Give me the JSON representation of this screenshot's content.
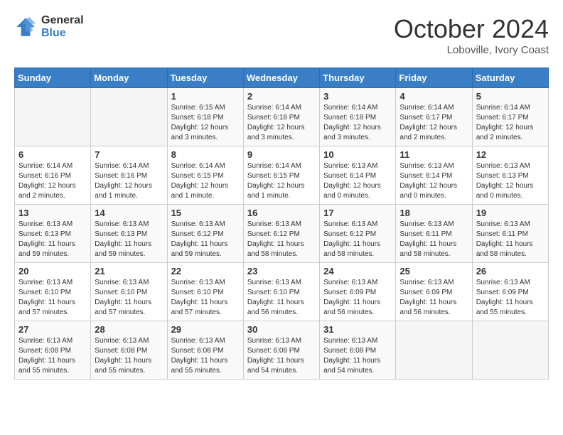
{
  "header": {
    "logo_general": "General",
    "logo_blue": "Blue",
    "month": "October 2024",
    "location": "Loboville, Ivory Coast"
  },
  "weekdays": [
    "Sunday",
    "Monday",
    "Tuesday",
    "Wednesday",
    "Thursday",
    "Friday",
    "Saturday"
  ],
  "weeks": [
    [
      {
        "day": "",
        "empty": true
      },
      {
        "day": "",
        "empty": true
      },
      {
        "day": "1",
        "sunrise": "6:15 AM",
        "sunset": "6:18 PM",
        "daylight": "12 hours and 3 minutes."
      },
      {
        "day": "2",
        "sunrise": "6:14 AM",
        "sunset": "6:18 PM",
        "daylight": "12 hours and 3 minutes."
      },
      {
        "day": "3",
        "sunrise": "6:14 AM",
        "sunset": "6:18 PM",
        "daylight": "12 hours and 3 minutes."
      },
      {
        "day": "4",
        "sunrise": "6:14 AM",
        "sunset": "6:17 PM",
        "daylight": "12 hours and 2 minutes."
      },
      {
        "day": "5",
        "sunrise": "6:14 AM",
        "sunset": "6:17 PM",
        "daylight": "12 hours and 2 minutes."
      }
    ],
    [
      {
        "day": "6",
        "sunrise": "6:14 AM",
        "sunset": "6:16 PM",
        "daylight": "12 hours and 2 minutes."
      },
      {
        "day": "7",
        "sunrise": "6:14 AM",
        "sunset": "6:16 PM",
        "daylight": "12 hours and 1 minute."
      },
      {
        "day": "8",
        "sunrise": "6:14 AM",
        "sunset": "6:15 PM",
        "daylight": "12 hours and 1 minute."
      },
      {
        "day": "9",
        "sunrise": "6:14 AM",
        "sunset": "6:15 PM",
        "daylight": "12 hours and 1 minute."
      },
      {
        "day": "10",
        "sunrise": "6:13 AM",
        "sunset": "6:14 PM",
        "daylight": "12 hours and 0 minutes."
      },
      {
        "day": "11",
        "sunrise": "6:13 AM",
        "sunset": "6:14 PM",
        "daylight": "12 hours and 0 minutes."
      },
      {
        "day": "12",
        "sunrise": "6:13 AM",
        "sunset": "6:13 PM",
        "daylight": "12 hours and 0 minutes."
      }
    ],
    [
      {
        "day": "13",
        "sunrise": "6:13 AM",
        "sunset": "6:13 PM",
        "daylight": "11 hours and 59 minutes."
      },
      {
        "day": "14",
        "sunrise": "6:13 AM",
        "sunset": "6:13 PM",
        "daylight": "11 hours and 59 minutes."
      },
      {
        "day": "15",
        "sunrise": "6:13 AM",
        "sunset": "6:12 PM",
        "daylight": "11 hours and 59 minutes."
      },
      {
        "day": "16",
        "sunrise": "6:13 AM",
        "sunset": "6:12 PM",
        "daylight": "11 hours and 58 minutes."
      },
      {
        "day": "17",
        "sunrise": "6:13 AM",
        "sunset": "6:12 PM",
        "daylight": "11 hours and 58 minutes."
      },
      {
        "day": "18",
        "sunrise": "6:13 AM",
        "sunset": "6:11 PM",
        "daylight": "11 hours and 58 minutes."
      },
      {
        "day": "19",
        "sunrise": "6:13 AM",
        "sunset": "6:11 PM",
        "daylight": "11 hours and 58 minutes."
      }
    ],
    [
      {
        "day": "20",
        "sunrise": "6:13 AM",
        "sunset": "6:10 PM",
        "daylight": "11 hours and 57 minutes."
      },
      {
        "day": "21",
        "sunrise": "6:13 AM",
        "sunset": "6:10 PM",
        "daylight": "11 hours and 57 minutes."
      },
      {
        "day": "22",
        "sunrise": "6:13 AM",
        "sunset": "6:10 PM",
        "daylight": "11 hours and 57 minutes."
      },
      {
        "day": "23",
        "sunrise": "6:13 AM",
        "sunset": "6:10 PM",
        "daylight": "11 hours and 56 minutes."
      },
      {
        "day": "24",
        "sunrise": "6:13 AM",
        "sunset": "6:09 PM",
        "daylight": "11 hours and 56 minutes."
      },
      {
        "day": "25",
        "sunrise": "6:13 AM",
        "sunset": "6:09 PM",
        "daylight": "11 hours and 56 minutes."
      },
      {
        "day": "26",
        "sunrise": "6:13 AM",
        "sunset": "6:09 PM",
        "daylight": "11 hours and 55 minutes."
      }
    ],
    [
      {
        "day": "27",
        "sunrise": "6:13 AM",
        "sunset": "6:08 PM",
        "daylight": "11 hours and 55 minutes."
      },
      {
        "day": "28",
        "sunrise": "6:13 AM",
        "sunset": "6:08 PM",
        "daylight": "11 hours and 55 minutes."
      },
      {
        "day": "29",
        "sunrise": "6:13 AM",
        "sunset": "6:08 PM",
        "daylight": "11 hours and 55 minutes."
      },
      {
        "day": "30",
        "sunrise": "6:13 AM",
        "sunset": "6:08 PM",
        "daylight": "11 hours and 54 minutes."
      },
      {
        "day": "31",
        "sunrise": "6:13 AM",
        "sunset": "6:08 PM",
        "daylight": "11 hours and 54 minutes."
      },
      {
        "day": "",
        "empty": true
      },
      {
        "day": "",
        "empty": true
      }
    ]
  ],
  "labels": {
    "sunrise": "Sunrise:",
    "sunset": "Sunset:",
    "daylight": "Daylight:"
  }
}
